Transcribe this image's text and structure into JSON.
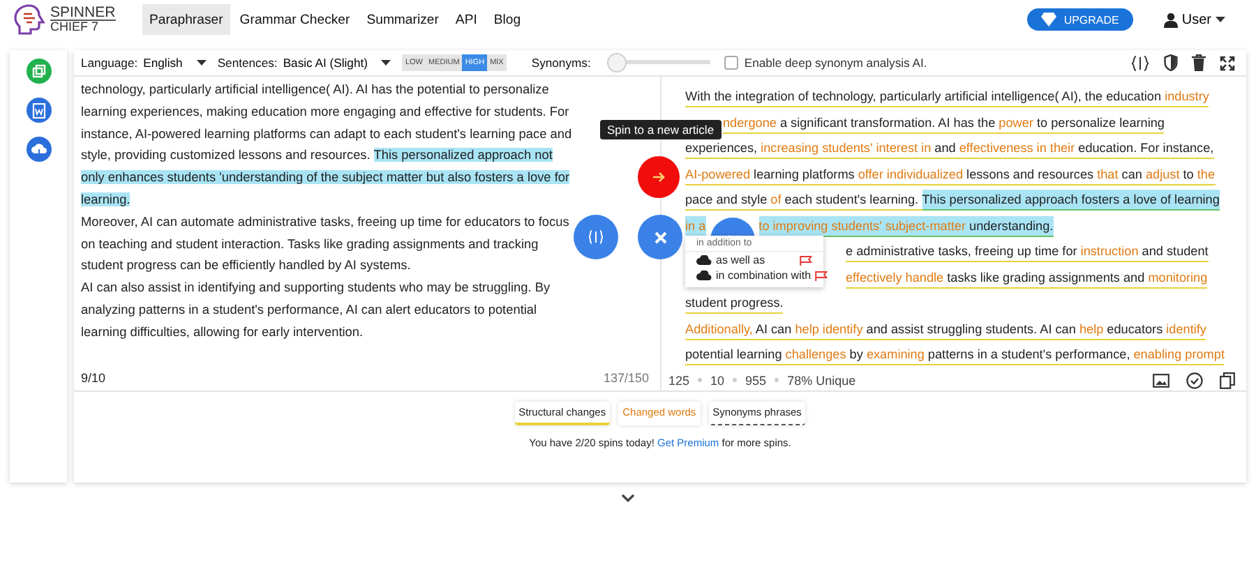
{
  "logo": {
    "line1": "SPINNER",
    "line2": "CHIEF 7"
  },
  "nav": [
    {
      "label": "Paraphraser",
      "selected": true
    },
    {
      "label": "Grammar Checker",
      "selected": false
    },
    {
      "label": "Summarizer",
      "selected": false
    },
    {
      "label": "API",
      "selected": false
    },
    {
      "label": "Blog",
      "selected": false
    }
  ],
  "upgrade": "UPGRADE",
  "user": "User",
  "toolbar": {
    "language_label": "Language:",
    "language": "English",
    "sentences_label": "Sentences:",
    "sentences": "Basic AI (Slight)",
    "modes": [
      {
        "label": "LOW",
        "selected": false
      },
      {
        "label": "MEDIUM",
        "selected": false
      },
      {
        "label": "HIGH",
        "selected": true
      },
      {
        "label": "MIX",
        "selected": false
      }
    ],
    "synonyms_label": "Synonyms:",
    "synonyms": {
      "level": 0
    },
    "deep": {
      "label": "Enable deep synonym analysis AI.",
      "checked": false
    }
  },
  "input": {
    "paragraphs": [
      [
        {
          "text": "technology, particularly artificial intelligence( AI). AI has the potential to personalize learning experiences, making education more engaging and effective for students. For instance, AI-powered learning platforms can adapt to each student's learning pace and style, providing customized lessons and resources. ",
          "highlight": false
        },
        {
          "text": "This personalized approach not only enhances students 'understanding of the subject matter but also fosters a love for learning.",
          "highlight": true
        }
      ],
      [
        {
          "text": "Moreover, AI can automate administrative tasks, freeing up time for educators to focus on teaching and student interaction. Tasks like grading assignments and tracking student progress can be efficiently handled by AI systems.",
          "highlight": false
        }
      ],
      [
        {
          "text": "AI can also assist in identifying and supporting students who may be struggling. By analyzing patterns in a student's performance, AI can alert educators to potential learning difficulties, allowing for early intervention.",
          "highlight": false
        }
      ]
    ],
    "sentences": "9/10",
    "count": "137/150"
  },
  "output": {
    "lines": [
      [
        {
          "text": "With the integration of technology, particularly artificial intelligence( AI), the education ",
          "kind": "plain",
          "highlight": false
        },
        {
          "text": "industry",
          "kind": "changed",
          "highlight": false
        }
      ],
      [
        {
          "text": "ndergone",
          "kind": "changed",
          "highlight": false
        },
        {
          "text": " a significant transformation. AI has the ",
          "kind": "plain",
          "highlight": false
        },
        {
          "text": "power",
          "kind": "changed",
          "highlight": false
        },
        {
          "text": " to personalize learning",
          "kind": "plain",
          "highlight": false
        }
      ],
      [
        {
          "text": "experiences, ",
          "kind": "plain",
          "highlight": false
        },
        {
          "text": "increasing students' interest in",
          "kind": "changed",
          "highlight": false
        },
        {
          "text": " and ",
          "kind": "plain",
          "highlight": false
        },
        {
          "text": "effectiveness in their",
          "kind": "changed",
          "highlight": false
        },
        {
          "text": " education. For instance,",
          "kind": "plain",
          "highlight": false
        }
      ],
      [
        {
          "text": "AI-powered",
          "kind": "changed",
          "highlight": false
        },
        {
          "text": " learning platforms ",
          "kind": "plain",
          "highlight": false
        },
        {
          "text": "offer individualized",
          "kind": "changed",
          "highlight": false
        },
        {
          "text": " lessons and resources ",
          "kind": "plain",
          "highlight": false
        },
        {
          "text": "that",
          "kind": "changed",
          "highlight": false
        },
        {
          "text": " can ",
          "kind": "plain",
          "highlight": false
        },
        {
          "text": "adjust",
          "kind": "changed",
          "highlight": false
        },
        {
          "text": " to ",
          "kind": "plain",
          "highlight": false
        },
        {
          "text": "the",
          "kind": "changed",
          "highlight": false
        }
      ],
      [
        {
          "text": "pace and style ",
          "kind": "plain",
          "highlight": false
        },
        {
          "text": "of",
          "kind": "changed",
          "highlight": false
        },
        {
          "text": " each student's learning. ",
          "kind": "plain",
          "highlight": false
        },
        {
          "text": "This personalized approach fosters a love of learning",
          "kind": "plain",
          "highlight": true
        }
      ],
      [
        {
          "text": "in a",
          "kind": "changed",
          "highlight": true
        },
        {
          "text": "to improving students' subject-matter",
          "kind": "changed",
          "highlight": true
        },
        {
          "text": " understanding.",
          "kind": "plain",
          "highlight": true
        }
      ],
      [
        {
          "text": "e administrative tasks, freeing up time for ",
          "kind": "plain",
          "highlight": false
        },
        {
          "text": "instruction",
          "kind": "changed",
          "highlight": false
        },
        {
          "text": " and student",
          "kind": "plain",
          "highlight": false
        }
      ],
      [
        {
          "text": "effectively handle",
          "kind": "changed",
          "highlight": false
        },
        {
          "text": " tasks like grading assignments and ",
          "kind": "plain",
          "highlight": false
        },
        {
          "text": "monitoring",
          "kind": "changed",
          "highlight": false
        }
      ],
      [
        {
          "text": "student progress.",
          "kind": "plain",
          "highlight": false
        }
      ],
      [
        {
          "text": "Additionally,",
          "kind": "changed",
          "highlight": false
        },
        {
          "text": " AI can ",
          "kind": "plain",
          "highlight": false
        },
        {
          "text": "help identify",
          "kind": "changed",
          "highlight": false
        },
        {
          "text": " and assist struggling students. AI can ",
          "kind": "plain",
          "highlight": false
        },
        {
          "text": "help",
          "kind": "changed",
          "highlight": false
        },
        {
          "text": " educators ",
          "kind": "plain",
          "highlight": false
        },
        {
          "text": "identify",
          "kind": "changed",
          "highlight": false
        }
      ],
      [
        {
          "text": "potential learning ",
          "kind": "plain",
          "highlight": false
        },
        {
          "text": "challenges",
          "kind": "changed",
          "highlight": false
        },
        {
          "text": " by ",
          "kind": "plain",
          "highlight": false
        },
        {
          "text": "examining",
          "kind": "changed",
          "highlight": false
        },
        {
          "text": " patterns in a student's performance, ",
          "kind": "plain",
          "highlight": false
        },
        {
          "text": "enabling prompt",
          "kind": "changed",
          "highlight": false
        }
      ]
    ],
    "stats": [
      "125",
      "10",
      "955",
      "78% Unique"
    ]
  },
  "tooltip": "Spin to a new article",
  "synonym_popup": {
    "title": "in addition to",
    "options": [
      "as well as",
      "in combination with"
    ]
  },
  "legend": [
    {
      "label": "Structural changes",
      "kind": "structural"
    },
    {
      "label": "Changed words",
      "kind": "changed"
    },
    {
      "label": "Synonyms phrases",
      "kind": "synonym"
    }
  ],
  "spins": {
    "before": "You have 2/20 spins today! ",
    "link": "Get Premium",
    "after": " for more spins."
  }
}
